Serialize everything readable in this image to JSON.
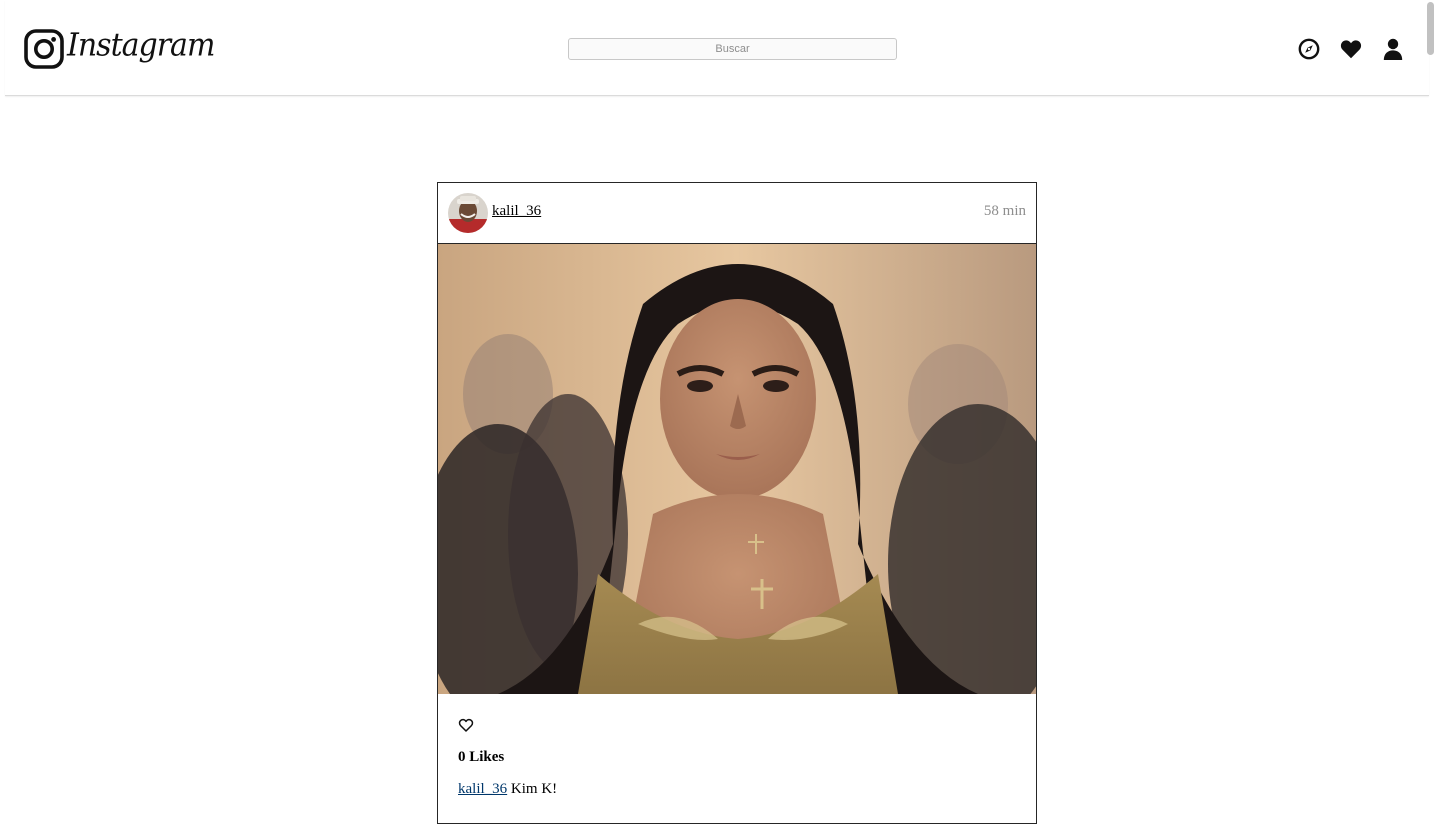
{
  "header": {
    "logo_text": "Instagram",
    "search_placeholder": "Buscar",
    "nav_icons": [
      "compass-icon",
      "heart-icon",
      "user-icon"
    ]
  },
  "post": {
    "username": "kalil_36",
    "timestamp": "58 min",
    "likes_label": "0 Likes",
    "caption_user": "kalil_36",
    "caption_text": "Kim K!"
  },
  "colors": {
    "link_blue": "#00376b",
    "muted_gray": "#8e8e8e",
    "border": "#262626"
  }
}
